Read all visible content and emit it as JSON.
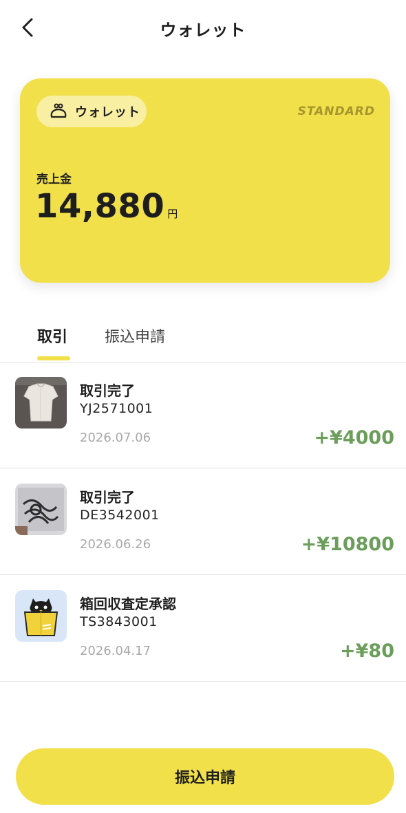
{
  "header": {
    "title": "ウォレット",
    "back_icon": "chevron-left-icon"
  },
  "card": {
    "chip_label": "ウォレット",
    "chip_icon": "wallet-icon",
    "tier": "STANDARD",
    "sales_label": "売上金",
    "amount": "14,880",
    "unit": "円",
    "color": "#f1e04a"
  },
  "tabs": [
    {
      "label": "取引",
      "active": true
    },
    {
      "label": "振込申請",
      "active": false
    }
  ],
  "transactions": [
    {
      "title": "取引完了",
      "id": "YJ2571001",
      "date": "2026.07.06",
      "amount": "+¥4000",
      "thumb": "shirt-photo"
    },
    {
      "title": "取引完了",
      "id": "DE3542001",
      "date": "2026.06.26",
      "amount": "+¥10800",
      "thumb": "cable-photo"
    },
    {
      "title": "箱回収査定承認",
      "id": "TS3843001",
      "date": "2026.04.17",
      "amount": "+¥80",
      "thumb": "cat-box-icon"
    }
  ],
  "footer": {
    "button_label": "振込申請"
  },
  "colors": {
    "accent": "#f1e04a",
    "amount_positive": "#6b9e5b",
    "date": "#a8a8a8"
  }
}
